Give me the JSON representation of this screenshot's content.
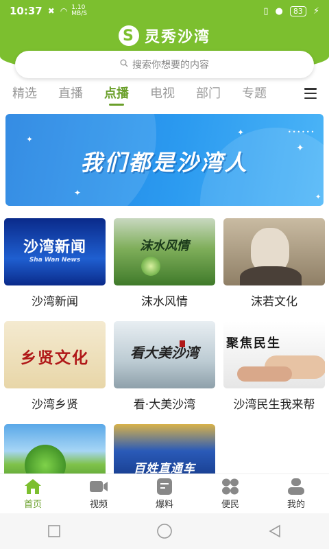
{
  "status_bar": {
    "time": "10:37",
    "speed_value": "1.10",
    "speed_unit": "MB/S",
    "battery": "83"
  },
  "app": {
    "title": "灵秀沙湾",
    "logo_letter": "S",
    "accent": "#7cbf2f"
  },
  "search": {
    "placeholder": "搜索你想要的内容"
  },
  "tabs": [
    {
      "label": "精选"
    },
    {
      "label": "直播"
    },
    {
      "label": "点播",
      "active": true
    },
    {
      "label": "电视"
    },
    {
      "label": "部门"
    },
    {
      "label": "专题"
    }
  ],
  "banner": {
    "text": "我们都是沙湾人"
  },
  "cards": [
    {
      "title": "沙湾新闻",
      "thumb_title": "沙湾新闻",
      "thumb_sub": "Sha Wan News"
    },
    {
      "title": "沫水风情",
      "thumb_title": "沫水风情"
    },
    {
      "title": "沫若文化"
    },
    {
      "title": "沙湾乡贤",
      "thumb_title": "乡贤文化"
    },
    {
      "title": "看·大美沙湾",
      "thumb_title": "看大美沙湾"
    },
    {
      "title": "沙湾民生我来帮",
      "thumb_title": "聚焦民生"
    },
    {
      "title": ""
    },
    {
      "title": "",
      "thumb_title": "百姓直通车"
    }
  ],
  "bottom_nav": [
    {
      "label": "首页",
      "icon": "home-icon",
      "active": true
    },
    {
      "label": "视频",
      "icon": "video-icon"
    },
    {
      "label": "爆料",
      "icon": "report-icon"
    },
    {
      "label": "便民",
      "icon": "services-icon"
    },
    {
      "label": "我的",
      "icon": "profile-icon"
    }
  ]
}
